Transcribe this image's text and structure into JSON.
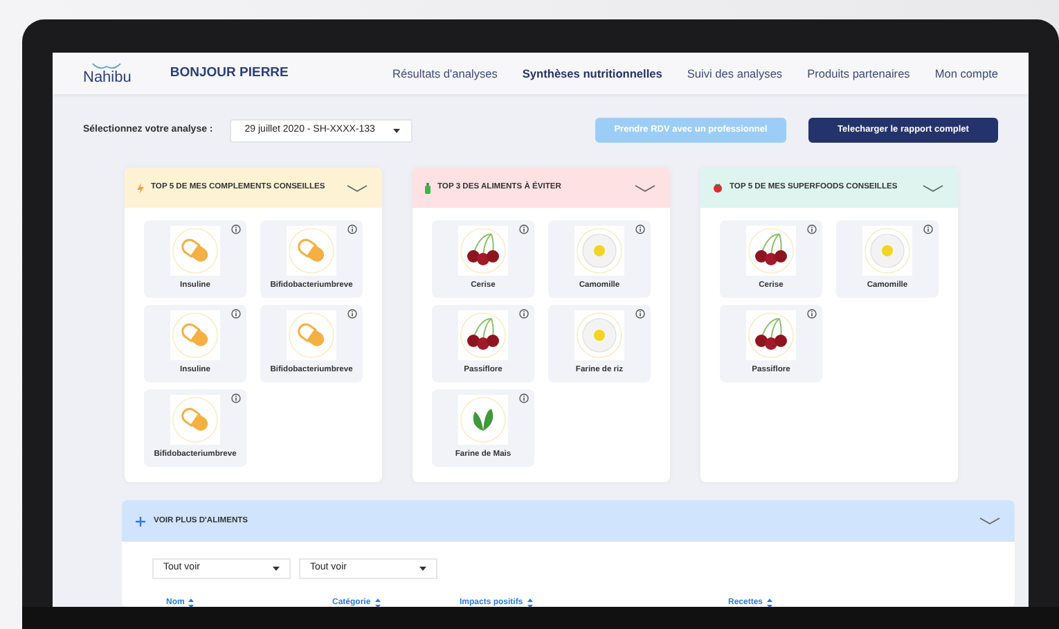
{
  "header": {
    "logo": "Nahibu",
    "greeting": "BONJOUR PIERRE",
    "nav": [
      {
        "label": "Résultats d'analyses",
        "selected": false
      },
      {
        "label": "Synthèses nutritionnelles",
        "selected": true
      },
      {
        "label": "Suivi des analyses",
        "selected": false
      },
      {
        "label": "Produits partenaires",
        "selected": false
      },
      {
        "label": "Mon compte",
        "selected": false
      }
    ]
  },
  "toolbar": {
    "label": "Sélectionnez votre analyse :",
    "analysis": "29 juillet 2020 - SH-XXXX-133",
    "buttons": [
      {
        "label": "Prendre RDV avec un professionnel",
        "kind": "light"
      },
      {
        "label": "Telecharger le rapport complet",
        "kind": "dark"
      }
    ]
  },
  "sections": [
    {
      "title": "TOP 5 DE MES COMPLEMENTS CONSEILLES",
      "kind": "supplements",
      "color": "#fdf3d4",
      "items": [
        {
          "name": "Insuline",
          "kind": "capsule"
        },
        {
          "name": "Bifidobacteriumbreve",
          "kind": "capsule"
        },
        {
          "name": "Insuline",
          "kind": "capsule"
        },
        {
          "name": "Bifidobacteriumbreve",
          "kind": "capsule"
        },
        {
          "name": "Bifidobacteriumbreve",
          "kind": "capsule"
        }
      ]
    },
    {
      "title": "TOP 3 DES ALIMENTS À ÉVITER",
      "kind": "avoid",
      "color": "#fde1e3",
      "items": [
        {
          "name": "Cerise",
          "kind": "cherry"
        },
        {
          "name": "Camomille",
          "kind": "daisy"
        },
        {
          "name": "Passiflore",
          "kind": "cherry"
        },
        {
          "name": "Farine de riz",
          "kind": "daisy"
        },
        {
          "name": "Farine de Mais",
          "kind": "mint"
        }
      ]
    },
    {
      "title": "TOP 5 DE MES SUPERFOODS CONSEILLES",
      "kind": "superfoods",
      "color": "#ddf5ee",
      "items": [
        {
          "name": "Cerise",
          "kind": "cherry"
        },
        {
          "name": "Camomille",
          "kind": "daisy"
        },
        {
          "name": "Passiflore",
          "kind": "cherry"
        }
      ]
    }
  ],
  "more": {
    "title": "VOIR PLUS D'ALIMENTS",
    "filters": [
      "Tout voir",
      "Tout voir"
    ],
    "columns": [
      "Nom",
      "Catégorie",
      "Impacts positifs",
      "Recettes"
    ]
  }
}
